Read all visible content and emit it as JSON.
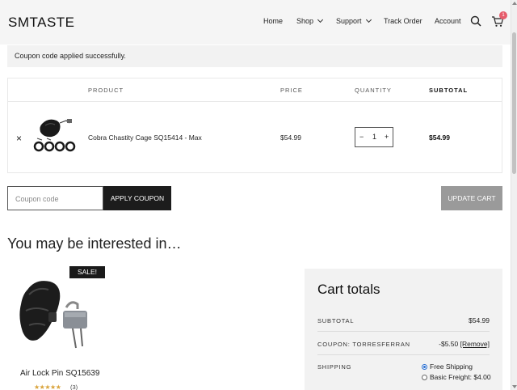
{
  "header": {
    "logo": "SMTASTE",
    "nav": [
      "Home",
      "Shop",
      "Support",
      "Track Order",
      "Account"
    ],
    "cart_count": "1"
  },
  "notice": "Coupon code applied successfully.",
  "table": {
    "headers": {
      "product": "PRODUCT",
      "price": "PRICE",
      "quantity": "QUANTITY",
      "subtotal": "SUBTOTAL"
    },
    "item": {
      "remove": "×",
      "name": "Cobra Chastity Cage SQ15414 - Max",
      "price": "$54.99",
      "qty": "1",
      "qty_minus": "−",
      "qty_plus": "+",
      "subtotal": "$54.99"
    }
  },
  "coupon": {
    "placeholder": "Coupon code",
    "apply_label": "APPLY COUPON",
    "update_label": "UPDATE CART"
  },
  "recommendations": {
    "heading": "You may be interested in…",
    "sale_badge": "SALE!",
    "product_name": "Air Lock Pin SQ15639",
    "stars": "★★★★★",
    "rating_count": "(3)"
  },
  "totals": {
    "title": "Cart totals",
    "subtotal_label": "SUBTOTAL",
    "subtotal_value": "$54.99",
    "coupon_label": "COUPON: TORRESFERRAN",
    "coupon_value": "-$5.50",
    "coupon_remove": "[Remove]",
    "shipping_label": "SHIPPING",
    "shipping_options": [
      "Free Shipping",
      "Basic Freight: $4.00"
    ]
  }
}
